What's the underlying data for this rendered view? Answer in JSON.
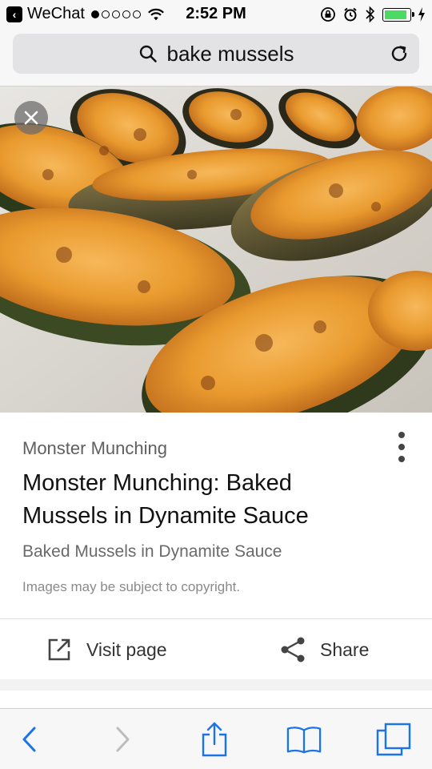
{
  "status_bar": {
    "app_back_label": "WeChat",
    "time": "2:52 PM",
    "signal_filled": 1,
    "signal_total": 5,
    "battery_level": 0.9,
    "battery_color": "#4cd964"
  },
  "url_bar": {
    "query": "bake mussels",
    "icon": "search-icon",
    "reload_icon": "reload-icon"
  },
  "image": {
    "close_icon": "close-icon",
    "subject": "baked mussels"
  },
  "result": {
    "source": "Monster Munching",
    "title": "Monster Munching: Baked Mussels in Dynamite Sauce",
    "subtitle": "Baked Mussels in Dynamite Sauce",
    "copyright": "Images may be subject to copyright.",
    "more_icon": "more-vert-icon"
  },
  "actions": {
    "visit_label": "Visit page",
    "share_label": "Share"
  },
  "toolbar": {
    "accent": "#1a73e8",
    "items": [
      "back-icon",
      "forward-icon",
      "share-icon",
      "bookmarks-icon",
      "tabs-icon"
    ]
  }
}
